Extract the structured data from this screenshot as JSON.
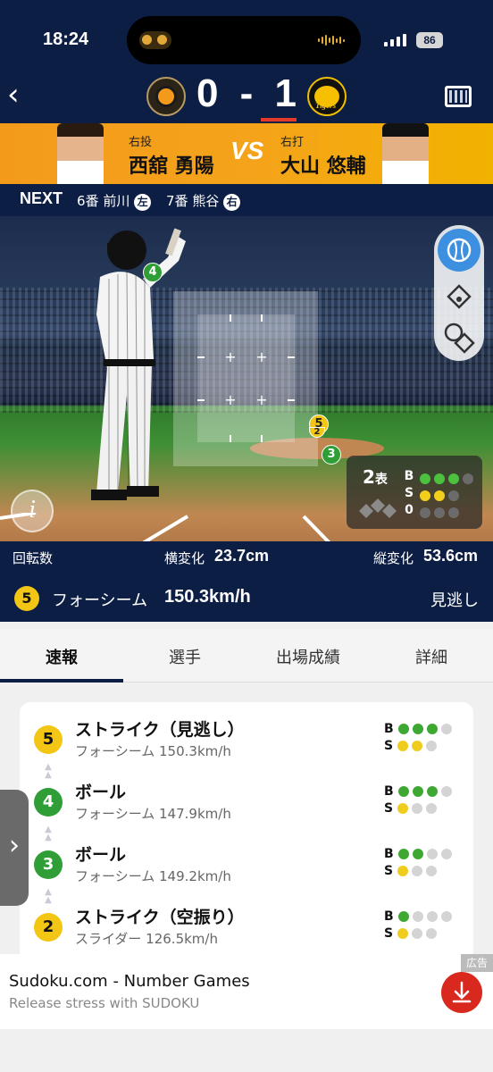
{
  "status": {
    "time": "18:24",
    "battery": "86"
  },
  "game": {
    "home_score": "0",
    "dash": "-",
    "away_score": "1"
  },
  "pitcher": {
    "role": "右投",
    "name": "西舘 勇陽"
  },
  "batter": {
    "role": "右打",
    "name": "大山 悠輔"
  },
  "vs_label": "VS",
  "next": {
    "label": "NEXT",
    "batters": [
      {
        "order": "6番",
        "name": "前川",
        "hand": "左"
      },
      {
        "order": "7番",
        "name": "熊谷",
        "hand": "右"
      }
    ]
  },
  "field": {
    "zone_pitches": [
      "4",
      "5",
      "2",
      "3"
    ],
    "inning": {
      "num": "2",
      "half": "表"
    },
    "count": {
      "b_label": "B",
      "s_label": "S",
      "outs": "0",
      "balls": 3,
      "strikes": 2
    },
    "info_icon": "i"
  },
  "stats": {
    "spin_label": "回転数",
    "hbreak_label": "横変化",
    "hbreak_value": "23.7cm",
    "vbreak_label": "縦変化",
    "vbreak_value": "53.6cm",
    "pitch_number": "5",
    "pitch_type": "フォーシーム",
    "pitch_speed": "150.3km/h",
    "result": "見逃し"
  },
  "tabs": [
    "速報",
    "選手",
    "出場成績",
    "詳細"
  ],
  "pitches": [
    {
      "num": "5",
      "color": "#f3c515",
      "title": "ストライク（見逃し）",
      "sub": "フォーシーム 150.3km/h",
      "b": 3,
      "s": 2
    },
    {
      "num": "4",
      "color": "#2f9e36",
      "title": "ボール",
      "sub": "フォーシーム 147.9km/h",
      "b": 3,
      "s": 1
    },
    {
      "num": "3",
      "color": "#2f9e36",
      "title": "ボール",
      "sub": "フォーシーム 149.2km/h",
      "b": 2,
      "s": 1
    },
    {
      "num": "2",
      "color": "#f3c515",
      "title": "ストライク（空振り）",
      "sub": "スライダー 126.5km/h",
      "b": 1,
      "s": 1
    }
  ],
  "ad": {
    "tag": "広告",
    "title": "Sudoku.com - Number Games",
    "subtitle": "Release stress with SUDOKU"
  },
  "colors": {
    "navy": "#0d1e45",
    "orange": "#f39a1b",
    "strike_yellow": "#f3c515",
    "ball_green": "#2f9e36",
    "red": "#d9291e"
  }
}
